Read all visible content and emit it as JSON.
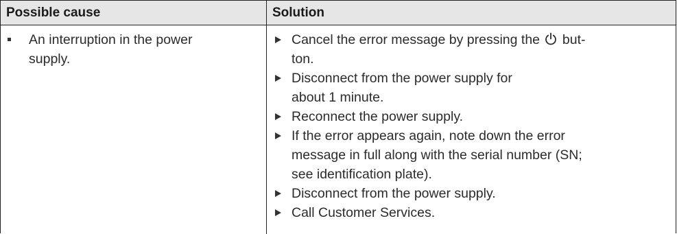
{
  "table": {
    "headers": {
      "cause": "Possible cause",
      "solution": "Solution"
    },
    "cause": {
      "line1": "An interruption in the power",
      "line2": "supply."
    },
    "steps": {
      "step1": {
        "line1_before_icon": "Cancel the error message by pressing the",
        "line1_after_icon": "but-",
        "line2": "ton.",
        "icon": "power-icon"
      },
      "step2": {
        "line1": "Disconnect from the power supply for",
        "line2": "about 1 minute."
      },
      "step3": {
        "line1": "Reconnect the power supply."
      },
      "step4": {
        "line1": "If the error appears again, note down the error",
        "line2": "message in full along with the serial number (SN;",
        "line3": "see identification plate)."
      },
      "step5": {
        "line1": "Disconnect from the power supply."
      },
      "step6": {
        "line1": "Call Customer Services."
      }
    }
  }
}
